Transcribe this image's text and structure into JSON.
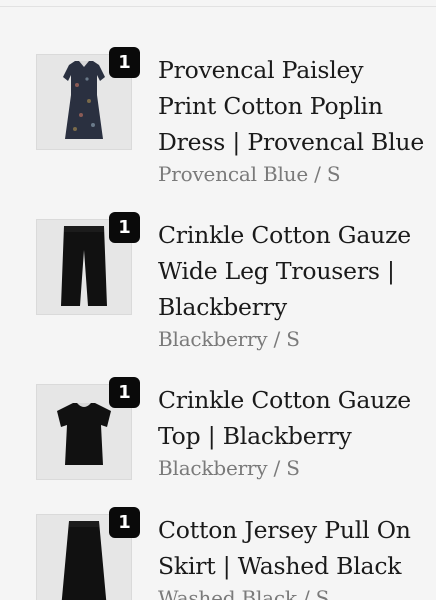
{
  "cart": {
    "items": [
      {
        "quantity": "1",
        "title": "Provencal Paisley Print Cotton Poplin Dress | Provencal Blue",
        "variant": "Provencal Blue / S",
        "image_icon": "dress-image"
      },
      {
        "quantity": "1",
        "title": "Crinkle Cotton Gauze Wide Leg Trousers | Blackberry",
        "variant": "Blackberry / S",
        "image_icon": "trousers-image"
      },
      {
        "quantity": "1",
        "title": "Crinkle Cotton Gauze Top | Blackberry",
        "variant": "Blackberry / S",
        "image_icon": "top-image"
      },
      {
        "quantity": "1",
        "title": "Cotton Jersey Pull On Skirt | Washed Black",
        "variant": "Washed Black / S",
        "image_icon": "skirt-image"
      }
    ]
  },
  "colors": {
    "background": "#f5f5f5",
    "badge": "#0a0a0a",
    "title": "#1a1a1a",
    "variant": "#7a7a7a",
    "dress": "#2a3040",
    "garment_black": "#111111"
  }
}
